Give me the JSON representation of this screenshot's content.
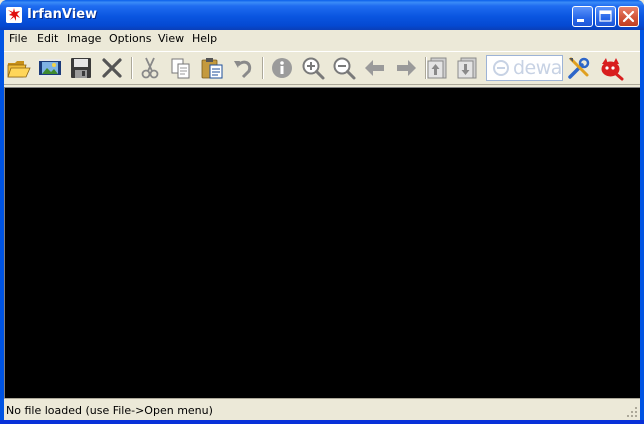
{
  "window": {
    "title": "IrfanView",
    "accent": "#0054E3"
  },
  "titlebar_buttons": {
    "minimize": "minimize-icon",
    "maximize": "maximize-icon",
    "close": "close-icon"
  },
  "menu": {
    "items": [
      {
        "label": "File"
      },
      {
        "label": "Edit"
      },
      {
        "label": "Image"
      },
      {
        "label": "Options"
      },
      {
        "label": "View"
      },
      {
        "label": "Help"
      }
    ]
  },
  "toolbar": {
    "tools": [
      {
        "name": "open-folder-icon"
      },
      {
        "name": "slideshow-icon"
      },
      {
        "name": "save-icon"
      },
      {
        "name": "delete-icon"
      },
      {
        "name": "cut-icon"
      },
      {
        "name": "copy-icon"
      },
      {
        "name": "paste-icon"
      },
      {
        "name": "undo-icon"
      },
      {
        "name": "info-icon"
      },
      {
        "name": "zoom-in-icon"
      },
      {
        "name": "zoom-out-icon"
      },
      {
        "name": "previous-icon"
      },
      {
        "name": "next-icon"
      },
      {
        "name": "first-page-icon"
      },
      {
        "name": "last-page-icon"
      },
      {
        "name": "properties-icon"
      },
      {
        "name": "irfanview-cat-icon"
      }
    ],
    "ad_text": "deway"
  },
  "image_area": {
    "background": "#000000"
  },
  "status": {
    "text": "No file loaded (use File->Open menu)"
  }
}
